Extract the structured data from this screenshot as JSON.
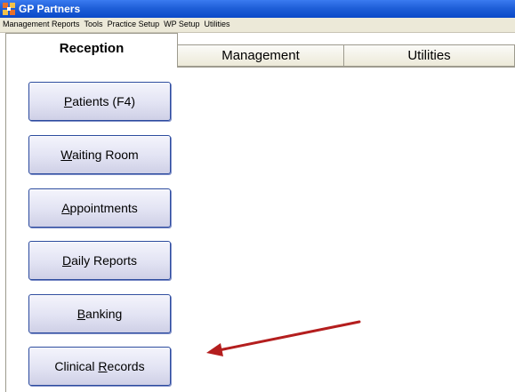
{
  "window": {
    "title": "GP Partners",
    "icon": "app-icon"
  },
  "menubar": {
    "items": [
      {
        "label": "Management Reports"
      },
      {
        "label": "Tools"
      },
      {
        "label": "Practice Setup"
      },
      {
        "label": "WP Setup"
      },
      {
        "label": "Utilities"
      }
    ]
  },
  "tabs": [
    {
      "label": "Reception",
      "active": true
    },
    {
      "label": "Management",
      "active": false
    },
    {
      "label": "Utilities",
      "active": false
    }
  ],
  "buttons": [
    {
      "name": "patients-button",
      "pre": "",
      "u": "P",
      "post": "atients (F4)"
    },
    {
      "name": "waiting-room-button",
      "pre": "",
      "u": "W",
      "post": "aiting Room"
    },
    {
      "name": "appointments-button",
      "pre": "",
      "u": "A",
      "post": "ppointments"
    },
    {
      "name": "daily-reports-button",
      "pre": "",
      "u": "D",
      "post": "aily Reports"
    },
    {
      "name": "banking-button",
      "pre": "",
      "u": "B",
      "post": "anking"
    },
    {
      "name": "clinical-records-button",
      "pre": "Clinical ",
      "u": "R",
      "post": "ecords"
    }
  ],
  "annotation": {
    "arrow_color": "#b41e1e",
    "points_to": "clinical-records-button"
  },
  "colors": {
    "titlebar": "#0a49c8",
    "menubar": "#ece9d8",
    "button_border": "#2b4a9e"
  }
}
